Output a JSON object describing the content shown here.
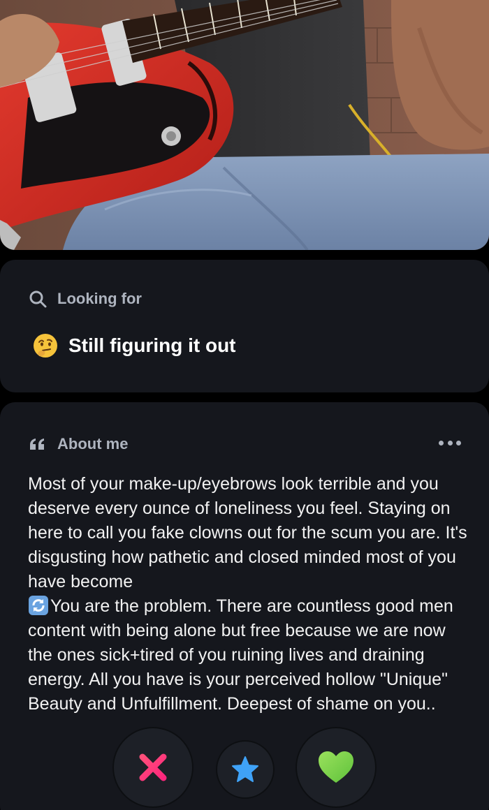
{
  "looking_for": {
    "label": "Looking for",
    "value": "Still figuring it out",
    "search_icon": "search-icon",
    "emoji": "thinking-face-emoji"
  },
  "about": {
    "label": "About me",
    "quote_icon": "quote-icon",
    "more_icon": "more-horizontal-icon",
    "bio_part1": "Most of your make-up/eyebrows look terrible and you deserve every ounce of loneliness you feel. Staying on here to call you fake clowns out for the scum you are. It's disgusting how pathetic and closed minded most of you have become",
    "sync_emoji": "counterclockwise-arrows-emoji",
    "bio_part2": "You are the problem. There are countless good men content with being alone but free because we are now the ones sick+tired of you ruining lives and draining energy. All you have is your perceived hollow \"Unique\" Beauty and Unfulfillment. Deepest of shame on you.."
  },
  "actions": {
    "nope_icon": "x-icon",
    "superlike_icon": "star-icon",
    "like_icon": "heart-icon"
  },
  "colors": {
    "background": "#000000",
    "card": "#15171d",
    "nope": "#fd267d",
    "superlike": "#3fa2f7",
    "like": "#7bd34b"
  }
}
